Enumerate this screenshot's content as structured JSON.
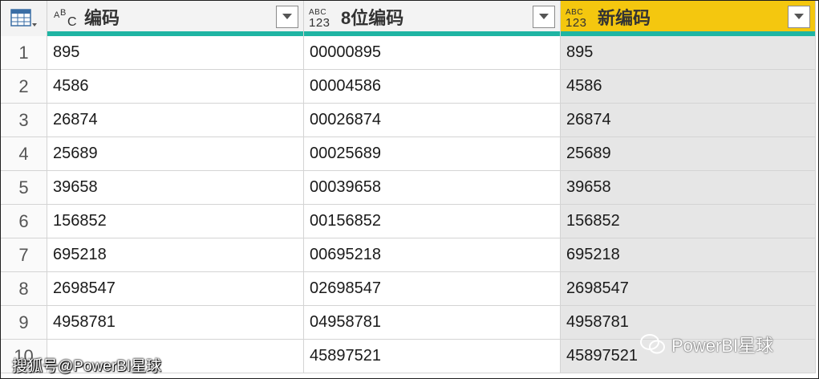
{
  "columns": [
    {
      "title": "编码",
      "type_icon": "abc-text-type-icon",
      "selected": false
    },
    {
      "title": "8位编码",
      "type_icon": "abc-123-any-type-icon",
      "selected": false
    },
    {
      "title": "新编码",
      "type_icon": "abc-123-any-type-icon",
      "selected": true
    }
  ],
  "type_icon_text": {
    "abc": "ABC",
    "num": "123",
    "a": "A",
    "b": "B",
    "c": "C"
  },
  "rows": [
    {
      "n": "1",
      "c1": "895",
      "c2": "00000895",
      "c3": "895"
    },
    {
      "n": "2",
      "c1": "4586",
      "c2": "00004586",
      "c3": "4586"
    },
    {
      "n": "3",
      "c1": "26874",
      "c2": "00026874",
      "c3": "26874"
    },
    {
      "n": "4",
      "c1": "25689",
      "c2": "00025689",
      "c3": "25689"
    },
    {
      "n": "5",
      "c1": "39658",
      "c2": "00039658",
      "c3": "39658"
    },
    {
      "n": "6",
      "c1": "156852",
      "c2": "00156852",
      "c3": "156852"
    },
    {
      "n": "7",
      "c1": "695218",
      "c2": "00695218",
      "c3": "695218"
    },
    {
      "n": "8",
      "c1": "2698547",
      "c2": "02698547",
      "c3": "2698547"
    },
    {
      "n": "9",
      "c1": "4958781",
      "c2": "04958781",
      "c3": "4958781"
    },
    {
      "n": "10",
      "c1": "",
      "c2": "45897521",
      "c3": "45897521"
    }
  ],
  "watermark": {
    "left": "搜狐号@PowerBI星球",
    "right": "PowerBI星球"
  },
  "colors": {
    "selected_header": "#f4c70f",
    "quality_bar": "#1fb5a3",
    "shaded_column": "#e6e6e6"
  }
}
